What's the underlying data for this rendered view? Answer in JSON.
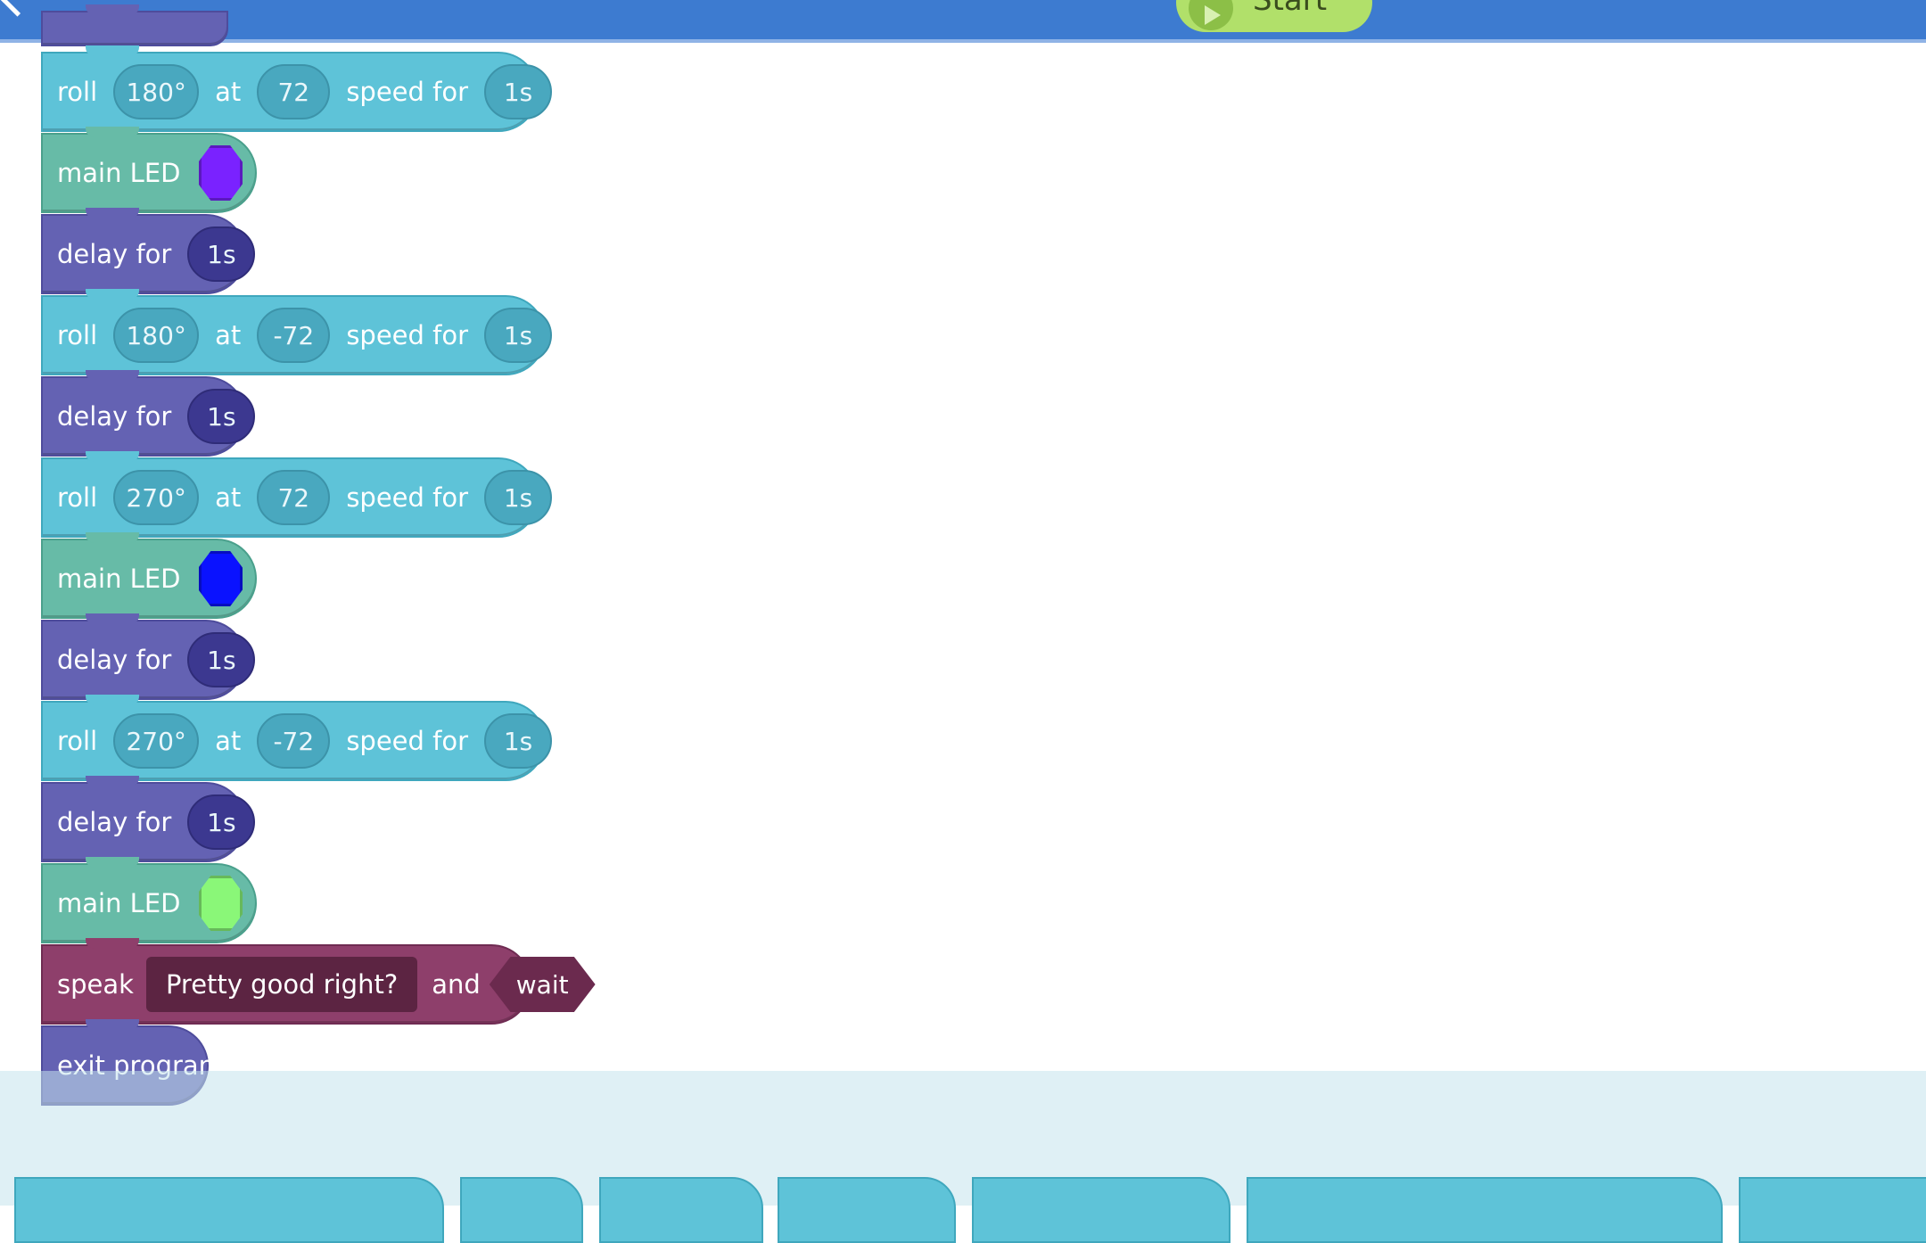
{
  "topbar": {
    "start_label": "Start"
  },
  "colors": {
    "roll": "#5ec3d8",
    "led": "#67bba7",
    "delay": "#6462b3",
    "speak": "#8e3f6b",
    "led_purple": "#7a22ff",
    "led_blue": "#0a12ff",
    "led_green": "#8af778"
  },
  "blocks": [
    {
      "type": "roll",
      "kw": "roll",
      "heading": "180°",
      "at": "at",
      "speed": "72",
      "speed_for": "speed for",
      "time": "1s"
    },
    {
      "type": "led",
      "kw": "main LED",
      "color": "#7a22ff"
    },
    {
      "type": "delay",
      "kw": "delay for",
      "time": "1s"
    },
    {
      "type": "roll",
      "kw": "roll",
      "heading": "180°",
      "at": "at",
      "speed": "-72",
      "speed_for": "speed for",
      "time": "1s"
    },
    {
      "type": "delay",
      "kw": "delay for",
      "time": "1s"
    },
    {
      "type": "roll",
      "kw": "roll",
      "heading": "270°",
      "at": "at",
      "speed": "72",
      "speed_for": "speed for",
      "time": "1s"
    },
    {
      "type": "led",
      "kw": "main LED",
      "color": "#0a12ff"
    },
    {
      "type": "delay",
      "kw": "delay for",
      "time": "1s"
    },
    {
      "type": "roll",
      "kw": "roll",
      "heading": "270°",
      "at": "at",
      "speed": "-72",
      "speed_for": "speed for",
      "time": "1s"
    },
    {
      "type": "delay",
      "kw": "delay for",
      "time": "1s"
    },
    {
      "type": "led",
      "kw": "main LED",
      "color": "#8af778"
    },
    {
      "type": "speak",
      "kw": "speak",
      "text": "Pretty good right?",
      "and": "and",
      "mode": "wait"
    },
    {
      "type": "exit",
      "kw": "exit program"
    }
  ]
}
